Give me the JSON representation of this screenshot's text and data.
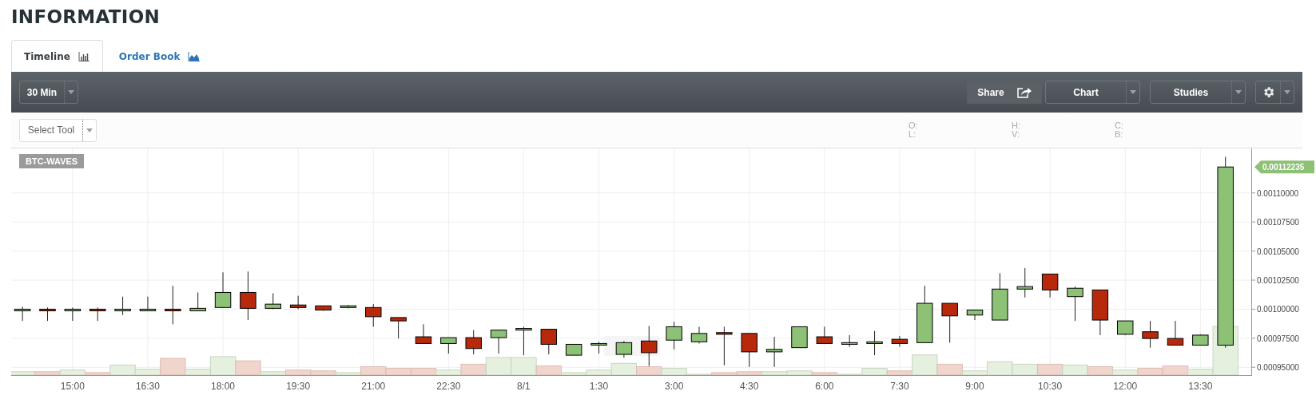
{
  "title": "INFORMATION",
  "tabs": [
    {
      "label": "Timeline",
      "selected": true,
      "kind": "bars"
    },
    {
      "label": "Order Book",
      "selected": false,
      "kind": "area"
    }
  ],
  "toolbar": {
    "interval": "30 Min",
    "share": "Share",
    "chart": "Chart",
    "studies": "Studies"
  },
  "drawing_toolbar": {
    "tool_select": "Select Tool",
    "readouts": [
      [
        "O:",
        "L:"
      ],
      [
        "H:",
        "V:"
      ],
      [
        "C:",
        "B:"
      ]
    ]
  },
  "chart": {
    "symbol": "BTC-WAVES",
    "last_price": "0.00112235",
    "y_axis_labels": [
      "0.00110000",
      "0.00107500",
      "0.00105000",
      "0.00102500",
      "0.00100000",
      "0.00097500",
      "0.00095000"
    ],
    "x_axis_labels": [
      "15:00",
      "16:30",
      "18:00",
      "19:30",
      "21:00",
      "22:30",
      "8/1",
      "1:30",
      "3:00",
      "4:30",
      "6:00",
      "7:30",
      "9:00",
      "10:30",
      "12:00",
      "13:30"
    ]
  }
}
